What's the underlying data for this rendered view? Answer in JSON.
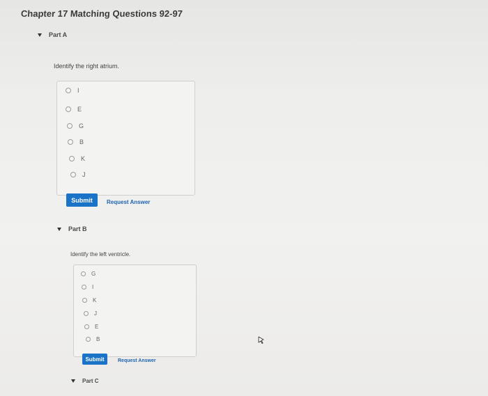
{
  "title": "Chapter 17 Matching Questions 92-97",
  "parts": [
    {
      "label": "Part A",
      "question": "Identify the right atrium.",
      "choices": [
        "I",
        "E",
        "G",
        "B",
        "K",
        "J"
      ],
      "submit_label": "Submit",
      "request_label": "Request Answer"
    },
    {
      "label": "Part B",
      "question": "Identify the left ventricle.",
      "choices": [
        "G",
        "I",
        "K",
        "J",
        "E",
        "B"
      ],
      "submit_label": "Submit",
      "request_label": "Request Answer"
    },
    {
      "label": "Part C"
    }
  ],
  "colors": {
    "submit_bg": "#1a73c7",
    "link": "#1e63b0"
  }
}
